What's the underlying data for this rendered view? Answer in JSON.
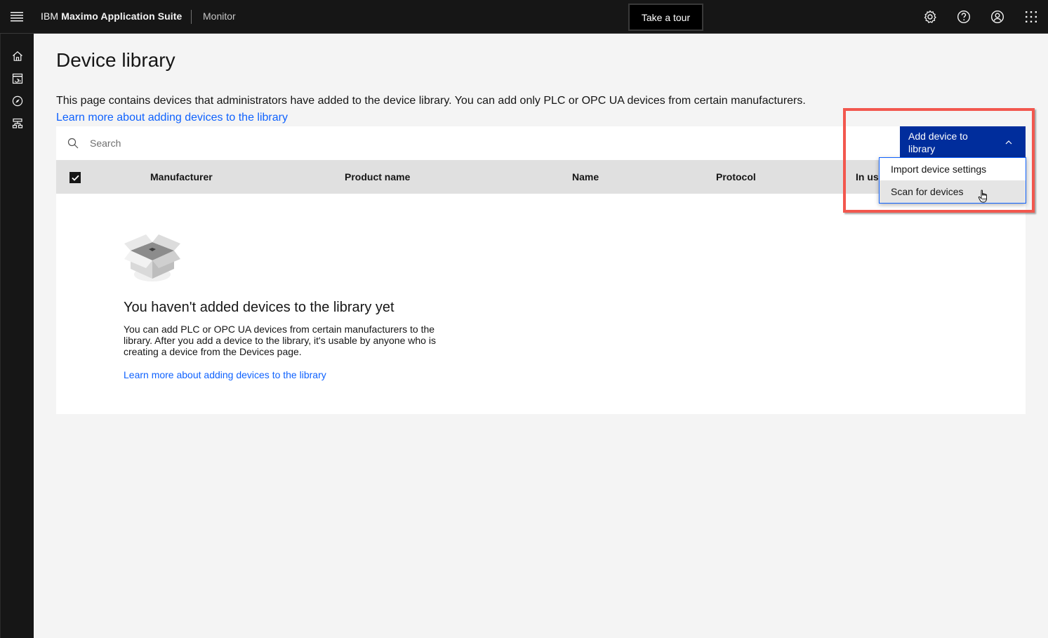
{
  "header": {
    "brand_prefix": "IBM",
    "brand_name": "Maximo Application Suite",
    "product": "Monitor",
    "tour_button": "Take a tour",
    "icons": [
      "gear-icon",
      "help-icon",
      "user-avatar-icon",
      "app-switcher-icon"
    ]
  },
  "sidenav": {
    "items": [
      {
        "name": "home",
        "icon": "home-icon"
      },
      {
        "name": "dashboard",
        "icon": "dashboard-icon"
      },
      {
        "name": "explore",
        "icon": "compass-icon"
      },
      {
        "name": "hierarchy",
        "icon": "hierarchy-icon"
      }
    ]
  },
  "page": {
    "title": "Device library",
    "description": "This page contains devices that administrators have added to the device library. You can add only PLC or OPC UA devices from certain manufacturers.",
    "learn_more": "Learn more about adding devices to the library"
  },
  "search": {
    "placeholder": "Search",
    "value": ""
  },
  "table": {
    "select_all_checked": true,
    "columns": [
      "Manufacturer",
      "Product name",
      "Name",
      "Protocol",
      "In us"
    ]
  },
  "empty_state": {
    "title": "You haven't added devices to the library yet",
    "body": "You can add PLC or OPC UA devices from certain manufacturers to the library. After you add a device to the library, it's usable by anyone who is creating a device from the Devices page.",
    "link": "Learn more about adding devices to the library"
  },
  "add_menu": {
    "button_label": "Add device to library",
    "expanded": true,
    "items": [
      {
        "label": "Import device settings",
        "hovered": false
      },
      {
        "label": "Scan for devices",
        "hovered": true
      }
    ]
  },
  "colors": {
    "primary_button": "#002d9c",
    "link": "#0f62fe",
    "highlight_annotation": "#f2574e",
    "header_bg": "#161616"
  }
}
